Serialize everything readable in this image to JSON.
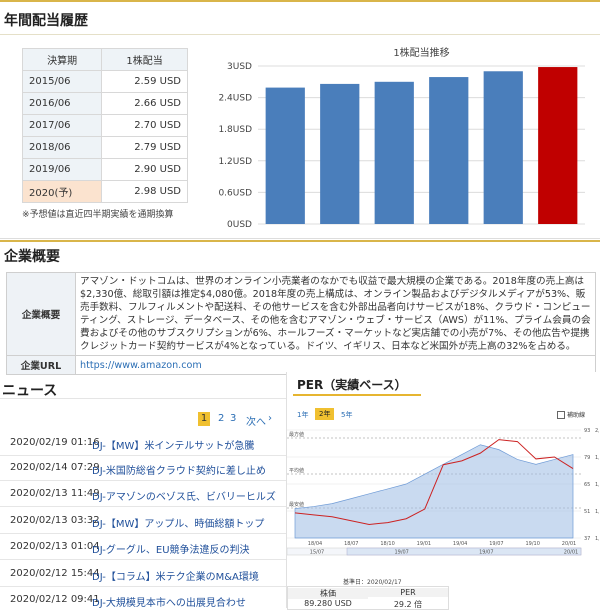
{
  "dividend": {
    "heading": "年間配当履歴",
    "table_headers": [
      "決算期",
      "1株配当"
    ],
    "rows": [
      {
        "year": "2015/06",
        "value": "2.59 USD"
      },
      {
        "year": "2016/06",
        "value": "2.66 USD"
      },
      {
        "year": "2017/06",
        "value": "2.70 USD"
      },
      {
        "year": "2018/06",
        "value": "2.79 USD"
      },
      {
        "year": "2019/06",
        "value": "2.90 USD"
      },
      {
        "year": "2020(予)",
        "value": "2.98 USD"
      }
    ],
    "note": "※予想値は直近四半期実績を通期換算"
  },
  "chart_data": [
    {
      "type": "bar",
      "title": "1株配当推移",
      "categories": [
        "2015/06",
        "2016/06",
        "2017/06",
        "2018/06",
        "2019/06",
        "2020(予)"
      ],
      "values": [
        2.59,
        2.66,
        2.7,
        2.79,
        2.9,
        2.98
      ],
      "ylim": [
        0,
        3
      ],
      "yticks": [
        "0USD",
        "0.6USD",
        "1.2USD",
        "1.8USD",
        "2.4USD",
        "3USD"
      ],
      "bar_color": "#4a7ebb",
      "highlight_color": "#c00000",
      "highlight_index": 5
    },
    {
      "type": "line",
      "title": "PER（実績ベース）",
      "range_tabs": [
        "1年",
        "2年",
        "5年"
      ],
      "active_tab": "2年",
      "checkbox_label": "補助線",
      "x_ticks": [
        "18/04",
        "18/07",
        "18/10",
        "19/01",
        "19/04",
        "19/07",
        "19/10",
        "20/01"
      ],
      "navigator_ticks": [
        "15/07",
        "19/07",
        "19/07",
        "20/01"
      ],
      "y_left_ticks": [
        "93",
        "79",
        "65",
        "51",
        "37"
      ],
      "y_right_ticks": [
        "2,1",
        "1,8",
        "1,4",
        "1,2",
        "1,0"
      ],
      "band_labels": [
        "最方値",
        "平均値",
        "最安値"
      ],
      "legend": [
        "株価(右軸)",
        "PER"
      ],
      "series": [
        {
          "name": "PER",
          "color": "#cc2222",
          "values": [
            50,
            49,
            48,
            46,
            44,
            45,
            47,
            52,
            75,
            77,
            81,
            88,
            87,
            78,
            79,
            73
          ]
        },
        {
          "name": "株価(右軸)",
          "color": "#9dbce3",
          "values": [
            1300,
            1320,
            1350,
            1400,
            1450,
            1500,
            1550,
            1650,
            1750,
            1850,
            1950,
            1900,
            1800,
            1750,
            1800,
            1850
          ]
        }
      ],
      "base_date_label": "基準日：2020/02/17",
      "table_headers": [
        "株価",
        "PER"
      ],
      "table_values": [
        "89.280 USD",
        "29.2 倍"
      ]
    }
  ],
  "company": {
    "heading": "企業概要",
    "label_overview": "企業概要",
    "overview_text": "アマゾン・ドットコムは、世界のオンライン小売業者のなかでも収益で最大規模の企業である。2018年度の売上高は$2,330億、総取引額は推定$4,080億。2018年度の売上構成は、オンライン製品およびデジタルメディアが53%、販売手数料、フルフィルメントや配送料、その他サービスを含む外部出品者向けサービスが18%、クラウド・コンピューティング、ストレージ、データベース、その他を含むアマゾン・ウェブ・サービス（AWS）が11%、プライム会員の会費およびその他のサブスクリプションが6%、ホールフーズ・マーケットなど実店舗での小売が7%、その他広告や提携クレジットカード契約サービスが4%となっている。ドイツ、イギリス、日本など米国外が売上高の32%を占める。",
    "label_url": "企業URL",
    "url": "https://www.amazon.com"
  },
  "news": {
    "heading": "ニュース",
    "pages": [
      "1",
      "2",
      "3"
    ],
    "next_label": "次へ",
    "items": [
      {
        "date": "2020/02/19 01:16",
        "title": "DJ-【MW】米インテルサットが急騰"
      },
      {
        "date": "2020/02/14 07:29",
        "title": "DJ-米国防総省クラウド契約に差し止め"
      },
      {
        "date": "2020/02/13 11:49",
        "title": "DJ-アマゾンのベゾス氏、ビバリーヒルズ"
      },
      {
        "date": "2020/02/13 03:32",
        "title": "DJ-【MW】アップル、時価総額トップ"
      },
      {
        "date": "2020/02/13 01:04",
        "title": "DJ-グーグル、EU競争法違反の判決"
      },
      {
        "date": "2020/02/12 15:44",
        "title": "DJ-【コラム】米テク企業のM&A環境"
      },
      {
        "date": "2020/02/12 09:41",
        "title": "DJ-大規模見本市への出展見合わせ"
      }
    ]
  }
}
